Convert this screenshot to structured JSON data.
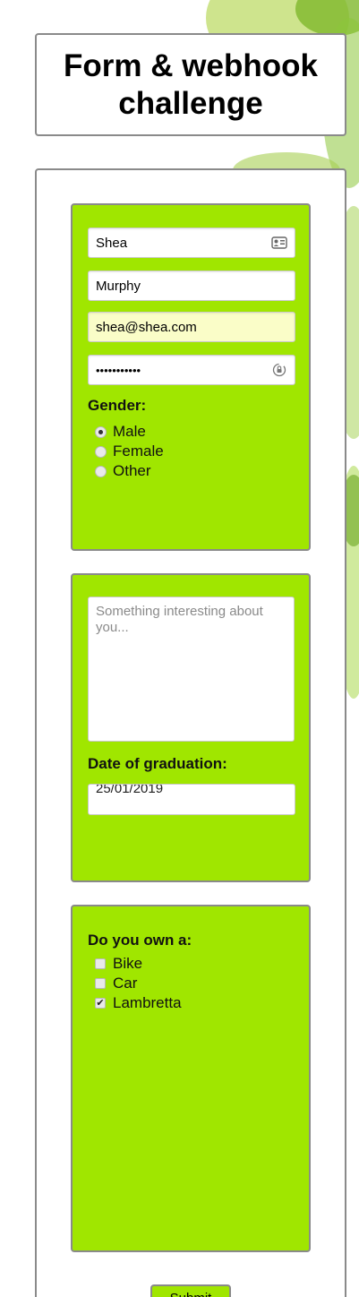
{
  "header": {
    "title": "Form & webhook challenge"
  },
  "personal": {
    "first_name": "Shea",
    "last_name": "Murphy",
    "email": "shea@shea.com",
    "password_mask": "•••••••••••",
    "contact_card_icon": "contact-card-icon",
    "password_key_icon": "password-key-icon"
  },
  "gender": {
    "label": "Gender:",
    "options": [
      {
        "label": "Male",
        "checked": true
      },
      {
        "label": "Female",
        "checked": false
      },
      {
        "label": "Other",
        "checked": false
      }
    ]
  },
  "about": {
    "placeholder": "Something interesting about you..."
  },
  "graduation": {
    "label": "Date of graduation:",
    "value": "25/01/2019"
  },
  "ownership": {
    "label": "Do you own a:",
    "options": [
      {
        "label": "Bike",
        "checked": false
      },
      {
        "label": "Car",
        "checked": false
      },
      {
        "label": "Lambretta",
        "checked": true
      }
    ]
  },
  "submit": {
    "label": "Submit"
  },
  "colors": {
    "panel_green": "#a0e600",
    "border_gray": "#8a8a8a",
    "autofill_yellow": "#fafdc8"
  }
}
